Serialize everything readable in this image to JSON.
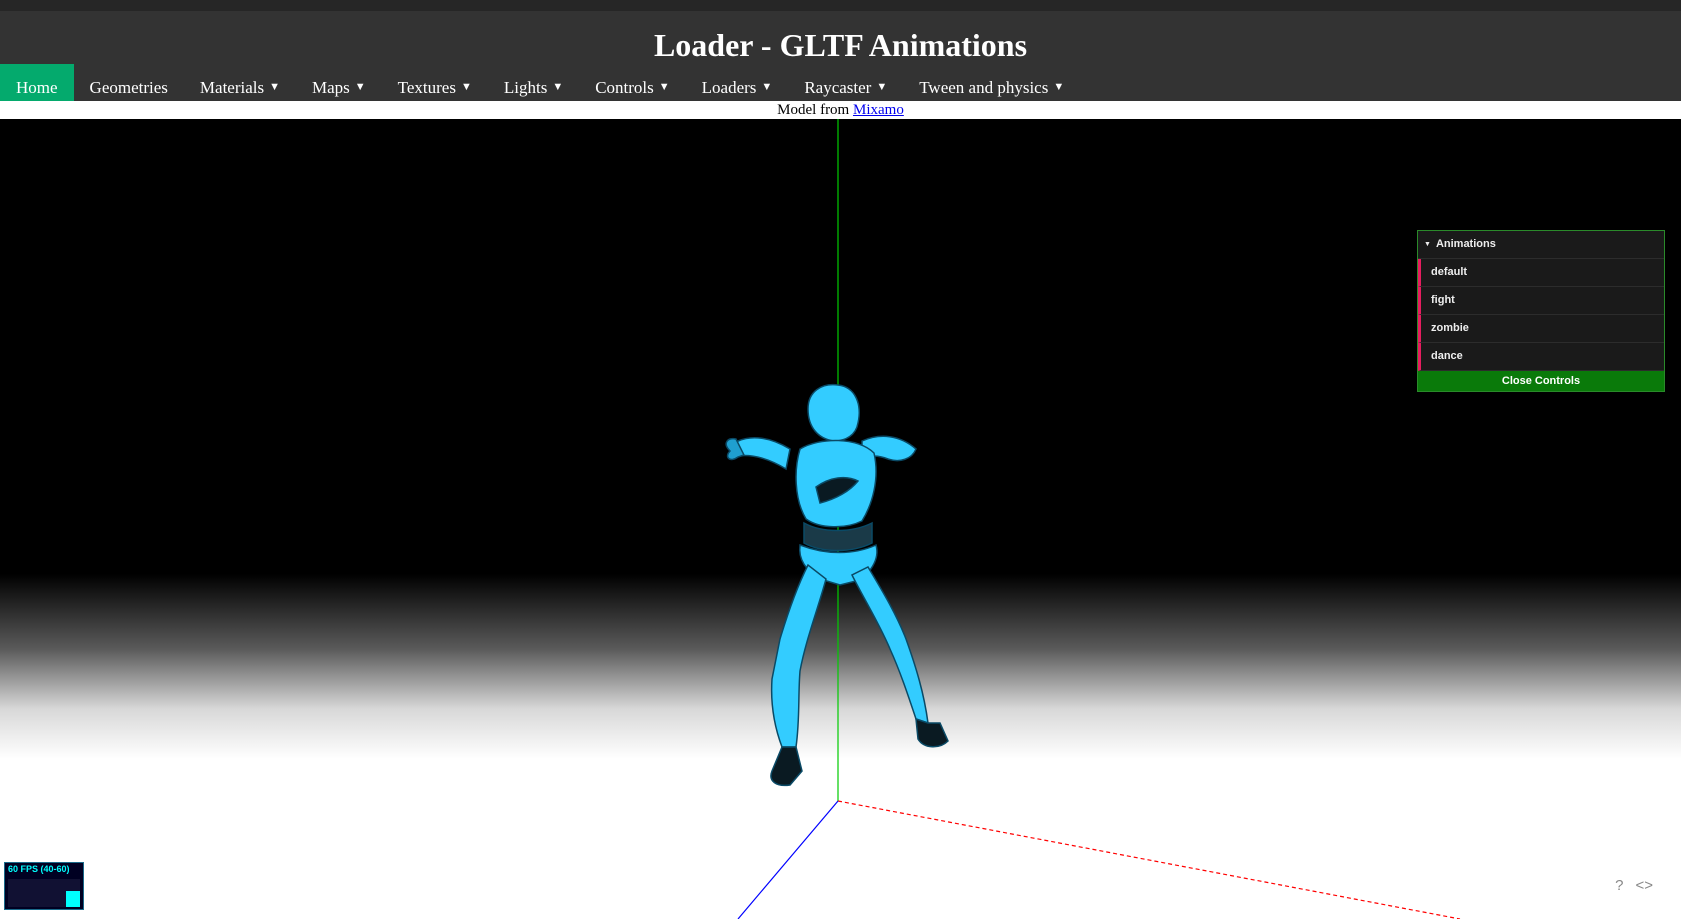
{
  "header": {
    "title": "Loader - GLTF Animations"
  },
  "nav": {
    "items": [
      {
        "label": "Home",
        "caret": ""
      },
      {
        "label": "Geometries",
        "caret": ""
      },
      {
        "label": "Materials",
        "caret": "▼"
      },
      {
        "label": "Maps",
        "caret": "▼"
      },
      {
        "label": "Textures",
        "caret": "▼"
      },
      {
        "label": "Lights",
        "caret": "▼"
      },
      {
        "label": "Controls",
        "caret": "▼"
      },
      {
        "label": "Loaders",
        "caret": "▼"
      },
      {
        "label": "Raycaster",
        "caret": "▼"
      },
      {
        "label": "Tween and physics",
        "caret": "▼"
      }
    ]
  },
  "credit": {
    "prefix": "Model from ",
    "link_text": "Mixamo"
  },
  "gui": {
    "folder_label": "Animations",
    "folder_icon": "triangle-down-icon",
    "animations": [
      "default",
      "fight",
      "zombie",
      "dance"
    ],
    "close_label": "Close Controls"
  },
  "stats": {
    "text": "60 FPS (40-60)"
  },
  "corner": {
    "help": "?",
    "source": "<>"
  },
  "colors": {
    "nav_active": "#04aa6d",
    "topbar": "#333333",
    "gui_accent": "#e61d5f",
    "close_button": "#0a7a0a",
    "model": "#33ccff",
    "axis_y": "#00cc00",
    "axis_x": "#ff0000",
    "axis_z": "#0000ff"
  }
}
